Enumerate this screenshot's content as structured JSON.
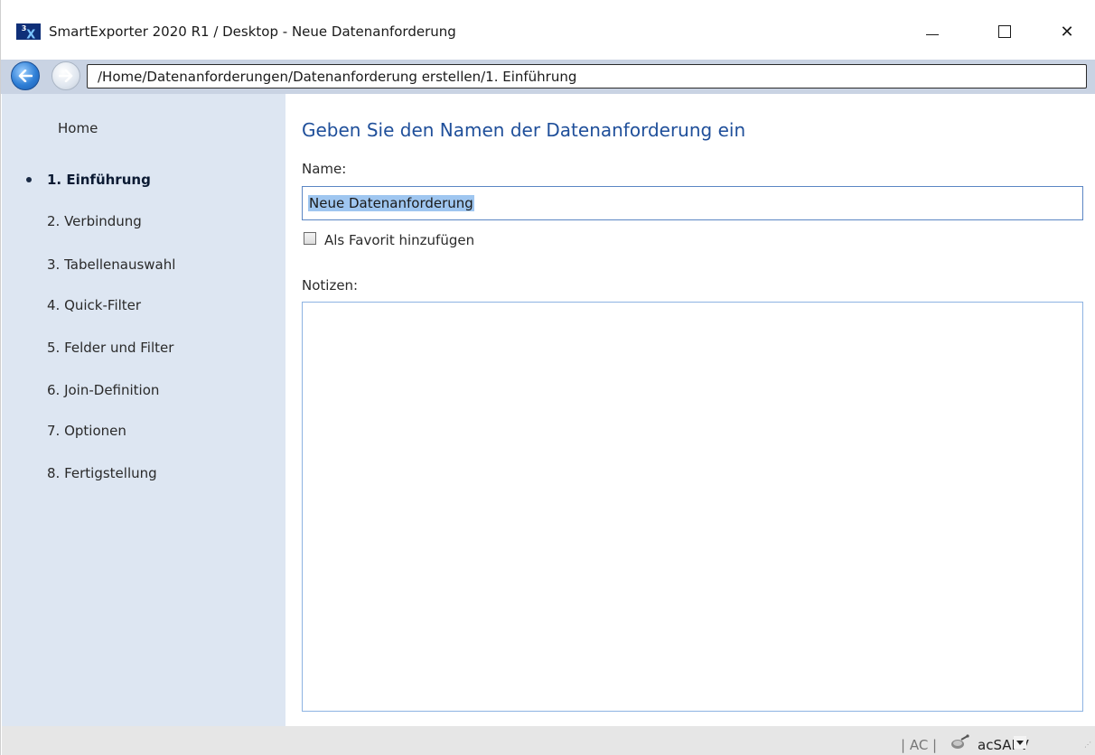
{
  "window": {
    "title": "SmartExporter 2020 R1 / Desktop - Neue Datenanforderung",
    "logo_text": "3X",
    "controls": {
      "minimize": "—",
      "maximize": "☐",
      "close": "✕"
    }
  },
  "navbar": {
    "path": "/Home/Datenanforderungen/Datenanforderung erstellen/1. Einführung"
  },
  "sidebar": {
    "items": [
      {
        "label": "Home",
        "active": false
      },
      {
        "label": "1. Einführung",
        "active": true
      },
      {
        "label": "2. Verbindung",
        "active": false
      },
      {
        "label": "3. Tabellenauswahl",
        "active": false
      },
      {
        "label": "4. Quick-Filter",
        "active": false
      },
      {
        "label": "5. Felder und Filter",
        "active": false
      },
      {
        "label": "6. Join-Definition",
        "active": false
      },
      {
        "label": "7. Optionen",
        "active": false
      },
      {
        "label": "8. Fertigstellung",
        "active": false
      }
    ]
  },
  "main": {
    "heading": "Geben Sie den Namen der Datenanforderung ein",
    "name_label": "Name:",
    "name_value": "Neue Datenanforderung",
    "favorite_label": "Als Favorit hinzufügen",
    "favorite_checked": false,
    "notes_label": "Notizen:",
    "notes_value": ""
  },
  "statusbar": {
    "ac": "| AC |",
    "user": "acSAPV"
  },
  "colors": {
    "sidebar_bg": "#dde6f2",
    "navbar_bg": "#c9d3e3",
    "heading": "#1f4f9a",
    "selection": "#9fc6f0"
  }
}
